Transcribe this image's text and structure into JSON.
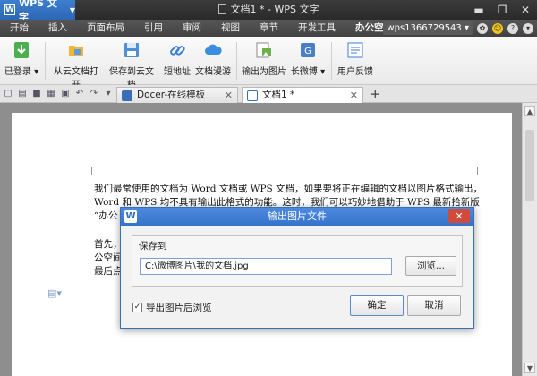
{
  "app": {
    "menu_button": "WPS 文字",
    "window_title": "文档1 * - WPS 文字",
    "logo_letter": "W"
  },
  "menu": {
    "items": [
      "开始",
      "插入",
      "页面布局",
      "引用",
      "审阅",
      "视图",
      "章节",
      "开发工具",
      "办公空间"
    ],
    "user": "wps1366729543",
    "user_arrow": "▾"
  },
  "ribbon": {
    "logged_in": "已登录",
    "open_cloud": "从云文档打开",
    "save_cloud": "保存到云文档",
    "short_url": "短地址",
    "doc_roam": "文档漫游",
    "export_image": "输出为图片",
    "weibo": "长微博",
    "feedback": "用户反馈"
  },
  "tabs": [
    {
      "label": "Docer-在线模板"
    },
    {
      "label": "文档1 *"
    }
  ],
  "document": {
    "lines": [
      "我们最常使用的文档为 Word 文档或 WPS 文档，如果要将正在编辑的文档以图片格式输出，",
      "Word 和 WPS 均不具有输出此格式的功能。这时，我们可以巧妙地借助于 WPS 最新拾新版",
      "“办公",
      "首先，",
      "公空间",
      "最后点"
    ]
  },
  "dialog": {
    "title": "输出图片文件",
    "close": "✕",
    "group_label": "保存到",
    "path_value": "C:\\微博图片\\我的文档.jpg",
    "browse": "浏览...",
    "checkbox_label": "导出图片后浏览",
    "checkbox_checked": true,
    "ok": "确定",
    "cancel": "取消"
  }
}
